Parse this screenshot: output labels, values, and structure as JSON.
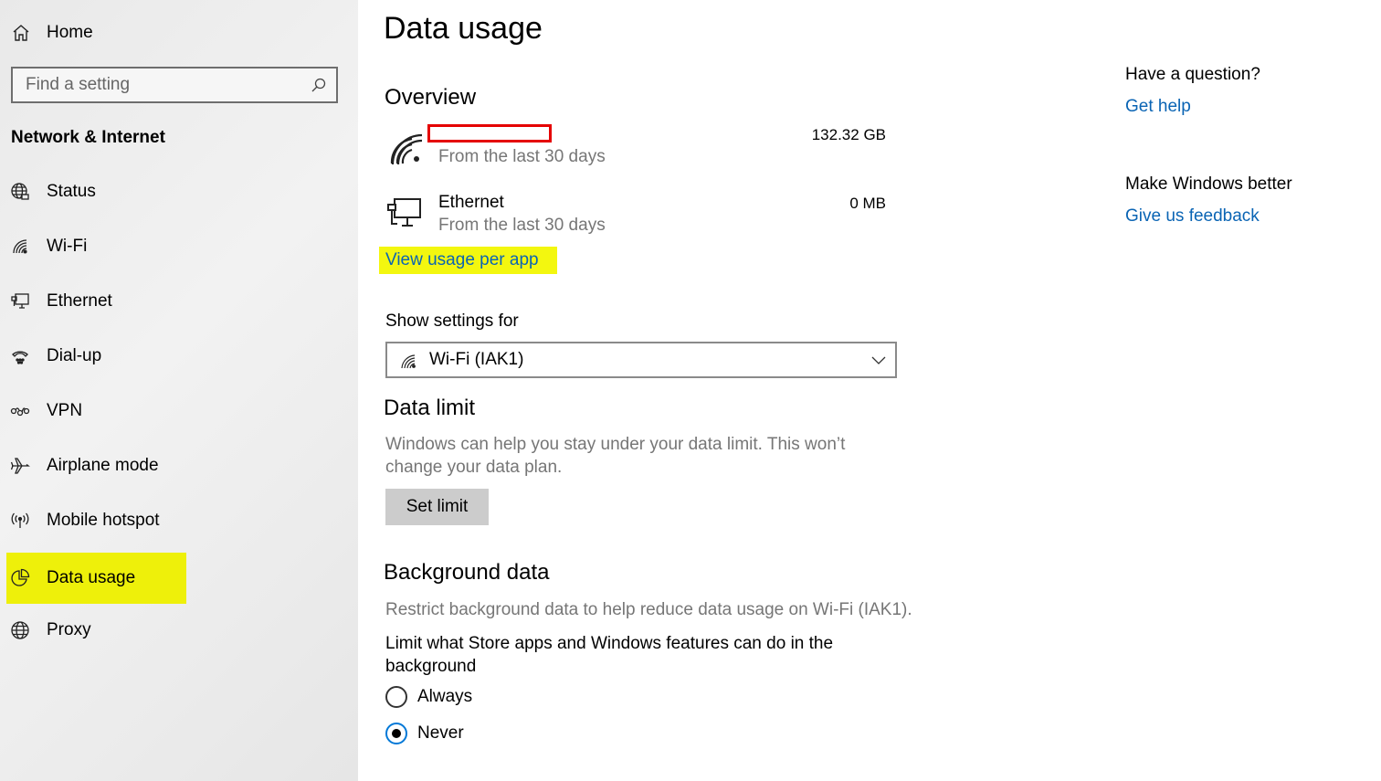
{
  "sidebar": {
    "home_label": "Home",
    "search_placeholder": "Find a setting",
    "section_title": "Network & Internet",
    "items": [
      {
        "label": "Status",
        "icon": "globe-status-icon"
      },
      {
        "label": "Wi-Fi",
        "icon": "wifi-icon"
      },
      {
        "label": "Ethernet",
        "icon": "ethernet-icon"
      },
      {
        "label": "Dial-up",
        "icon": "dialup-icon"
      },
      {
        "label": "VPN",
        "icon": "vpn-icon"
      },
      {
        "label": "Airplane mode",
        "icon": "airplane-icon"
      },
      {
        "label": "Mobile hotspot",
        "icon": "hotspot-icon"
      },
      {
        "label": "Data usage",
        "icon": "pie-chart-icon",
        "selected": true
      },
      {
        "label": "Proxy",
        "icon": "globe-icon"
      }
    ],
    "highlight_color": "#eef00a"
  },
  "main": {
    "title": "Data usage",
    "overview": {
      "heading": "Overview",
      "networks": [
        {
          "name": "",
          "sub": "From the last 30 days",
          "usage": "132.32 GB",
          "icon": "wifi-icon"
        },
        {
          "name": "Ethernet",
          "sub": "From the last 30 days",
          "usage": "0 MB",
          "icon": "ethernet-icon"
        }
      ],
      "per_app_link": "View usage per app"
    },
    "show_settings_for": {
      "label": "Show settings for",
      "selected": "Wi-Fi (IAK1)"
    },
    "data_limit": {
      "heading": "Data limit",
      "desc_line1": "Windows can help you stay under your data limit. This won’t",
      "desc_line2": "change your data plan.",
      "button": "Set limit"
    },
    "background_data": {
      "heading": "Background data",
      "desc": "Restrict background data to help reduce data usage on Wi-Fi (IAK1).",
      "limit_line1": "Limit what Store apps and Windows features can do in the",
      "limit_line2": "background",
      "options": [
        {
          "label": "Always",
          "checked": false
        },
        {
          "label": "Never",
          "checked": true
        }
      ]
    }
  },
  "right": {
    "question_heading": "Have a question?",
    "help_link": "Get help",
    "better_heading": "Make Windows better",
    "feedback_link": "Give us feedback"
  },
  "colors": {
    "accent_link": "#0a64b4",
    "radio_accent": "#0078d7",
    "redaction_border": "#e50000",
    "link_highlight": "#f3f70f"
  }
}
